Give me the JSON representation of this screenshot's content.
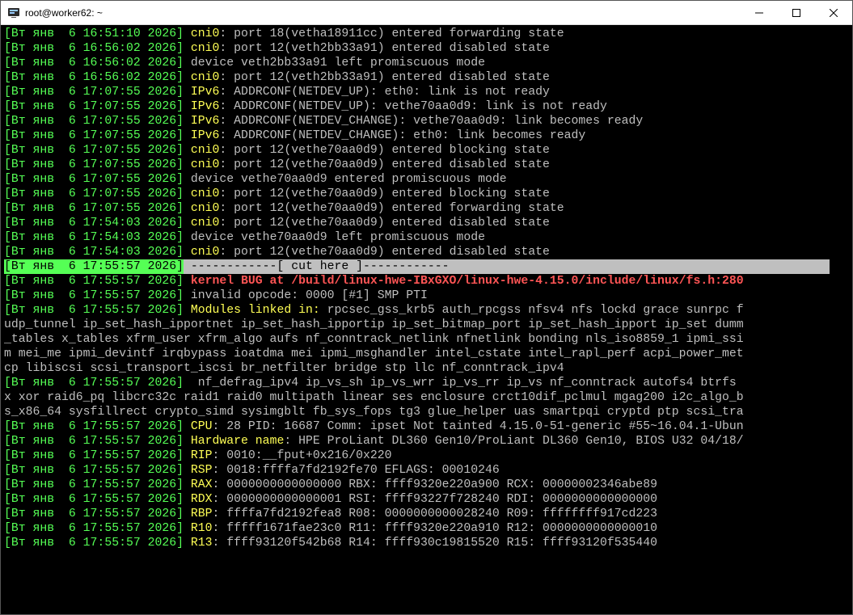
{
  "window": {
    "title": "root@worker62: ~"
  },
  "log": {
    "lines": [
      {
        "kind": "kern",
        "ts": "[Вт янв  6 16:51:10 2026]",
        "lbl": "cni0",
        "msg": ": port 18(vetha18911cc) entered forwarding state"
      },
      {
        "kind": "kern",
        "ts": "[Вт янв  6 16:56:02 2026]",
        "lbl": "cni0",
        "msg": ": port 12(veth2bb33a91) entered disabled state"
      },
      {
        "kind": "plain",
        "ts": "[Вт янв  6 16:56:02 2026]",
        "msg": "device veth2bb33a91 left promiscuous mode"
      },
      {
        "kind": "kern",
        "ts": "[Вт янв  6 16:56:02 2026]",
        "lbl": "cni0",
        "msg": ": port 12(veth2bb33a91) entered disabled state"
      },
      {
        "kind": "kern",
        "ts": "[Вт янв  6 17:07:55 2026]",
        "lbl": "IPv6",
        "msg": ": ADDRCONF(NETDEV_UP): eth0: link is not ready"
      },
      {
        "kind": "kern",
        "ts": "[Вт янв  6 17:07:55 2026]",
        "lbl": "IPv6",
        "msg": ": ADDRCONF(NETDEV_UP): vethe70aa0d9: link is not ready"
      },
      {
        "kind": "kern",
        "ts": "[Вт янв  6 17:07:55 2026]",
        "lbl": "IPv6",
        "msg": ": ADDRCONF(NETDEV_CHANGE): vethe70aa0d9: link becomes ready"
      },
      {
        "kind": "kern",
        "ts": "[Вт янв  6 17:07:55 2026]",
        "lbl": "IPv6",
        "msg": ": ADDRCONF(NETDEV_CHANGE): eth0: link becomes ready"
      },
      {
        "kind": "kern",
        "ts": "[Вт янв  6 17:07:55 2026]",
        "lbl": "cni0",
        "msg": ": port 12(vethe70aa0d9) entered blocking state"
      },
      {
        "kind": "kern",
        "ts": "[Вт янв  6 17:07:55 2026]",
        "lbl": "cni0",
        "msg": ": port 12(vethe70aa0d9) entered disabled state"
      },
      {
        "kind": "plain",
        "ts": "[Вт янв  6 17:07:55 2026]",
        "msg": "device vethe70aa0d9 entered promiscuous mode"
      },
      {
        "kind": "kern",
        "ts": "[Вт янв  6 17:07:55 2026]",
        "lbl": "cni0",
        "msg": ": port 12(vethe70aa0d9) entered blocking state"
      },
      {
        "kind": "kern",
        "ts": "[Вт янв  6 17:07:55 2026]",
        "lbl": "cni0",
        "msg": ": port 12(vethe70aa0d9) entered forwarding state"
      },
      {
        "kind": "kern",
        "ts": "[Вт янв  6 17:54:03 2026]",
        "lbl": "cni0",
        "msg": ": port 12(vethe70aa0d9) entered disabled state"
      },
      {
        "kind": "plain",
        "ts": "[Вт янв  6 17:54:03 2026]",
        "msg": "device vethe70aa0d9 left promiscuous mode"
      },
      {
        "kind": "kern",
        "ts": "[Вт янв  6 17:54:03 2026]",
        "lbl": "cni0",
        "msg": ": port 12(vethe70aa0d9) entered disabled state"
      },
      {
        "kind": "cut",
        "ts": "[Вт янв  6 17:55:57 2026]",
        "msg": " ------------[ cut here ]------------"
      },
      {
        "kind": "bug",
        "ts": "[Вт янв  6 17:55:57 2026]",
        "msg": " kernel BUG at /build/linux-hwe-IBxGXO/linux-hwe-4.15.0/include/linux/fs.h:280"
      },
      {
        "kind": "plain",
        "ts": "[Вт янв  6 17:55:57 2026]",
        "msg": "invalid opcode: 0000 [#1] SMP PTI"
      },
      {
        "kind": "mods",
        "ts": "[Вт янв  6 17:55:57 2026]",
        "lbl": "Modules linked in:",
        "msg": " rpcsec_gss_krb5 auth_rpcgss nfsv4 nfs lockd grace sunrpc f"
      },
      {
        "kind": "raw",
        "msg": "udp_tunnel ip_set_hash_ipportnet ip_set_hash_ipportip ip_set_bitmap_port ip_set_hash_ipport ip_set dumm"
      },
      {
        "kind": "raw",
        "msg": "_tables x_tables xfrm_user xfrm_algo aufs nf_conntrack_netlink nfnetlink bonding nls_iso8859_1 ipmi_ssi"
      },
      {
        "kind": "raw",
        "msg": "m mei_me ipmi_devintf irqbypass ioatdma mei ipmi_msghandler intel_cstate intel_rapl_perf acpi_power_met"
      },
      {
        "kind": "raw",
        "msg": "cp libiscsi scsi_transport_iscsi br_netfilter bridge stp llc nf_conntrack_ipv4"
      },
      {
        "kind": "plain",
        "ts": "[Вт янв  6 17:55:57 2026]",
        "msg": " nf_defrag_ipv4 ip_vs_sh ip_vs_wrr ip_vs_rr ip_vs nf_conntrack autofs4 btrfs"
      },
      {
        "kind": "raw",
        "msg": "x xor raid6_pq libcrc32c raid1 raid0 multipath linear ses enclosure crct10dif_pclmul mgag200 i2c_algo_b"
      },
      {
        "kind": "raw",
        "msg": "s_x86_64 sysfillrect crypto_simd sysimgblt fb_sys_fops tg3 glue_helper uas smartpqi cryptd ptp scsi_tra"
      },
      {
        "kind": "reg",
        "ts": "[Вт янв  6 17:55:57 2026]",
        "lbl": "CPU",
        "msg": ": 28 PID: 16687 Comm: ipset Not tainted 4.15.0-51-generic #55~16.04.1-Ubun"
      },
      {
        "kind": "reg",
        "ts": "[Вт янв  6 17:55:57 2026]",
        "lbl": "Hardware name",
        "msg": ": HPE ProLiant DL360 Gen10/ProLiant DL360 Gen10, BIOS U32 04/18/"
      },
      {
        "kind": "reg",
        "ts": "[Вт янв  6 17:55:57 2026]",
        "lbl": "RIP",
        "msg": ": 0010:__fput+0x216/0x220"
      },
      {
        "kind": "reg",
        "ts": "[Вт янв  6 17:55:57 2026]",
        "lbl": "RSP",
        "msg": ": 0018:ffffa7fd2192fe70 EFLAGS: 00010246"
      },
      {
        "kind": "reg",
        "ts": "[Вт янв  6 17:55:57 2026]",
        "lbl": "RAX",
        "msg": ": 0000000000000000 RBX: ffff9320e220a900 RCX: 00000002346abe89"
      },
      {
        "kind": "reg",
        "ts": "[Вт янв  6 17:55:57 2026]",
        "lbl": "RDX",
        "msg": ": 0000000000000001 RSI: ffff93227f728240 RDI: 0000000000000000"
      },
      {
        "kind": "reg",
        "ts": "[Вт янв  6 17:55:57 2026]",
        "lbl": "RBP",
        "msg": ": ffffa7fd2192fea8 R08: 0000000000028240 R09: ffffffff917cd223"
      },
      {
        "kind": "reg",
        "ts": "[Вт янв  6 17:55:57 2026]",
        "lbl": "R10",
        "msg": ": fffff1671fae23c0 R11: ffff9320e220a910 R12: 0000000000000010"
      },
      {
        "kind": "reg",
        "ts": "[Вт янв  6 17:55:57 2026]",
        "lbl": "R13",
        "msg": ": ffff93120f542b68 R14: ffff930c19815520 R15: ffff93120f535440"
      }
    ]
  }
}
